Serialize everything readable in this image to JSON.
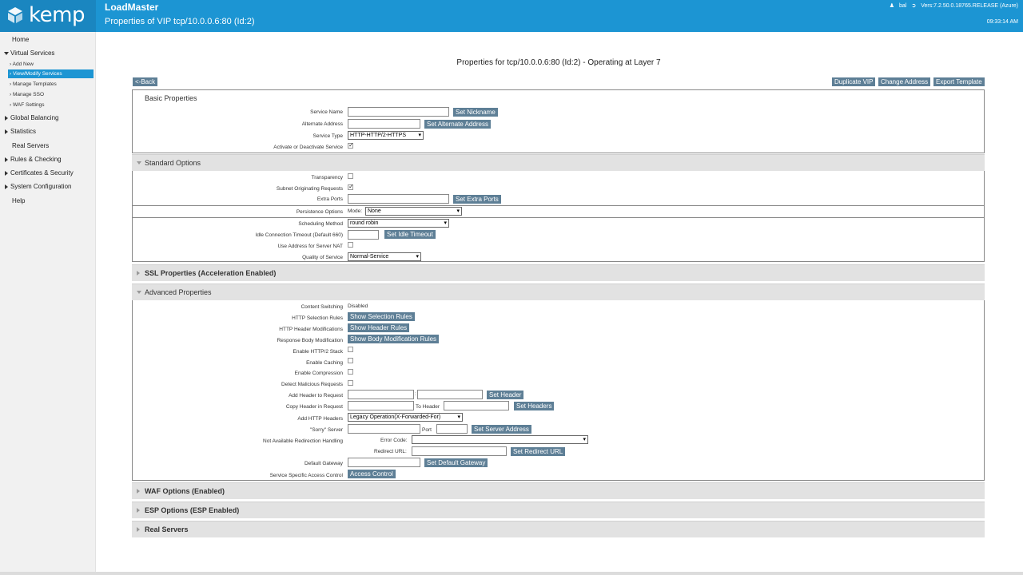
{
  "header": {
    "logo_text": "kemp",
    "app_title": "LoadMaster",
    "page_heading": "Properties of VIP tcp/10.0.0.6:80 (Id:2)",
    "user": "bal",
    "version": "Vers:7.2.50.0.18765.RELEASE (Azure)",
    "clock": "09:33:14 AM"
  },
  "sidebar": {
    "home": "Home",
    "virtual_services": "Virtual Services",
    "vs_items": [
      "Add New",
      "View/Modify Services",
      "Manage Templates",
      "Manage SSO",
      "WAF Settings"
    ],
    "global_balancing": "Global Balancing",
    "statistics": "Statistics",
    "real_servers": "Real Servers",
    "rules_checking": "Rules & Checking",
    "certificates": "Certificates & Security",
    "system_config": "System Configuration",
    "help": "Help"
  },
  "main": {
    "title": "Properties for tcp/10.0.0.6:80 (Id:2) - Operating at Layer 7",
    "back": "<-Back",
    "duplicate_vip": "Duplicate VIP",
    "change_address": "Change Address",
    "export_template": "Export Template"
  },
  "basic": {
    "heading": "Basic Properties",
    "service_name_label": "Service Name",
    "set_nickname": "Set Nickname",
    "alternate_address_label": "Alternate Address",
    "set_alternate_address": "Set Alternate Address",
    "service_type_label": "Service Type",
    "service_type_value": "HTTP-HTTP/2-HTTPS",
    "activate_label": "Activate or Deactivate Service"
  },
  "standard": {
    "heading": "Standard Options",
    "transparency_label": "Transparency",
    "subnet_label": "Subnet Originating Requests",
    "extra_ports_label": "Extra Ports",
    "set_extra_ports": "Set Extra Ports",
    "persistence_label": "Persistence Options",
    "mode_label": "Mode:",
    "mode_value": "None",
    "scheduling_label": "Scheduling Method",
    "scheduling_value": "round robin",
    "idle_label": "Idle Connection Timeout (Default 660)",
    "set_idle_timeout": "Set Idle Timeout",
    "use_address_label": "Use Address for Server NAT",
    "qos_label": "Quality of Service",
    "qos_value": "Normal-Service"
  },
  "ssl": {
    "heading": "SSL Properties (Acceleration Enabled)"
  },
  "advanced": {
    "heading": "Advanced Properties",
    "content_switching_label": "Content Switching",
    "content_switching_value": "Disabled",
    "http_selection_label": "HTTP Selection Rules",
    "show_selection_rules": "Show Selection Rules",
    "header_mod_label": "HTTP Header Modifications",
    "show_header_rules": "Show Header Rules",
    "body_mod_label": "Response Body Modification",
    "show_body_rules": "Show Body Modification Rules",
    "http2_label": "Enable HTTP/2 Stack",
    "caching_label": "Enable Caching",
    "compression_label": "Enable Compression",
    "malicious_label": "Detect Malicious Requests",
    "add_header_label": "Add Header to Request",
    "set_header": "Set Header",
    "copy_header_label": "Copy Header in Request",
    "to_header": "To Header",
    "set_headers": "Set Headers",
    "add_http_headers_label": "Add HTTP Headers",
    "add_http_headers_value": "Legacy Operation(X-Forwarded-For)",
    "sorry_label": "\"Sorry\" Server",
    "port_label": "Port",
    "set_server_address": "Set Server Address",
    "not_available_label": "Not Available Redirection Handling",
    "error_code_label": "Error Code:",
    "redirect_url_label": "Redirect URL:",
    "set_redirect_url": "Set Redirect URL",
    "default_gateway_label": "Default Gateway",
    "set_default_gateway": "Set Default Gateway",
    "access_control_label": "Service Specific Access Control",
    "access_control": "Access Control"
  },
  "waf": {
    "heading": "WAF Options (Enabled)"
  },
  "esp": {
    "heading": "ESP Options (ESP Enabled)"
  },
  "real_servers": {
    "heading": "Real Servers"
  }
}
